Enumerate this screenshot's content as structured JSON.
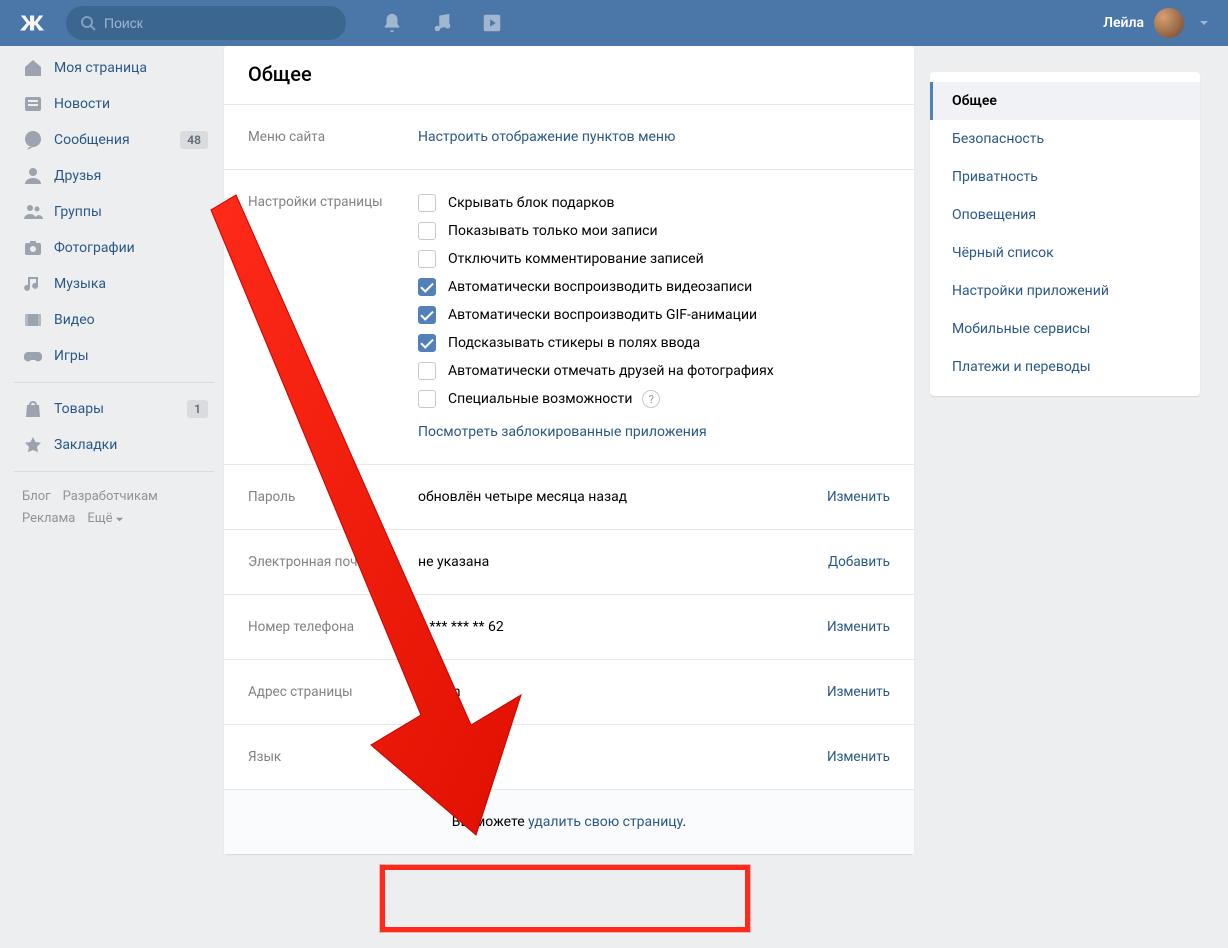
{
  "header": {
    "search_placeholder": "Поиск",
    "username": "Лейла"
  },
  "sidebar": {
    "items": [
      {
        "label": "Моя страница",
        "icon": "home"
      },
      {
        "label": "Новости",
        "icon": "news"
      },
      {
        "label": "Сообщения",
        "icon": "messages",
        "badge": "48"
      },
      {
        "label": "Друзья",
        "icon": "friends"
      },
      {
        "label": "Группы",
        "icon": "groups"
      },
      {
        "label": "Фотографии",
        "icon": "photos"
      },
      {
        "label": "Музыка",
        "icon": "music"
      },
      {
        "label": "Видео",
        "icon": "video"
      },
      {
        "label": "Игры",
        "icon": "games"
      }
    ],
    "items2": [
      {
        "label": "Товары",
        "icon": "market",
        "badge": "1"
      },
      {
        "label": "Закладки",
        "icon": "bookmark"
      }
    ],
    "footer": {
      "blog": "Блог",
      "dev": "Разработчикам",
      "ads": "Реклама",
      "more": "Ещё"
    }
  },
  "settings": {
    "title": "Общее",
    "menu": {
      "label": "Меню сайта",
      "link": "Настроить отображение пунктов меню"
    },
    "page": {
      "label": "Настройки страницы",
      "checks": [
        {
          "label": "Скрывать блок подарков",
          "checked": false
        },
        {
          "label": "Показывать только мои записи",
          "checked": false
        },
        {
          "label": "Отключить комментирование записей",
          "checked": false
        },
        {
          "label": "Автоматически воспроизводить видеозаписи",
          "checked": true
        },
        {
          "label": "Автоматически воспроизводить GIF-анимации",
          "checked": true
        },
        {
          "label": "Подсказывать стикеры в полях ввода",
          "checked": true
        },
        {
          "label": "Автоматически отмечать друзей на фотографиях",
          "checked": false
        },
        {
          "label": "Специальные возможности",
          "checked": false,
          "help": true
        }
      ],
      "blocked_link": "Посмотреть заблокированные приложения"
    },
    "password": {
      "label": "Пароль",
      "value": "обновлён четыре месяца назад",
      "action": "Изменить"
    },
    "email": {
      "label": "Электронная почта",
      "value": "не указана",
      "action": "Добавить"
    },
    "phone": {
      "label": "Номер телефона",
      "value": "7 *** *** ** 62",
      "action": "Изменить"
    },
    "url": {
      "label": "Адрес страницы",
      "value": "h           .com",
      "action": "Изменить"
    },
    "lang": {
      "label": "Язык",
      "value": "Русский",
      "action": "Изменить"
    },
    "delete": {
      "prefix": "Вы можете ",
      "link": "удалить свою страницу",
      "suffix": "."
    }
  },
  "rightmenu": [
    "Общее",
    "Безопасность",
    "Приватность",
    "Оповещения",
    "Чёрный список",
    "Настройки приложений",
    "Мобильные сервисы",
    "Платежи и переводы"
  ]
}
